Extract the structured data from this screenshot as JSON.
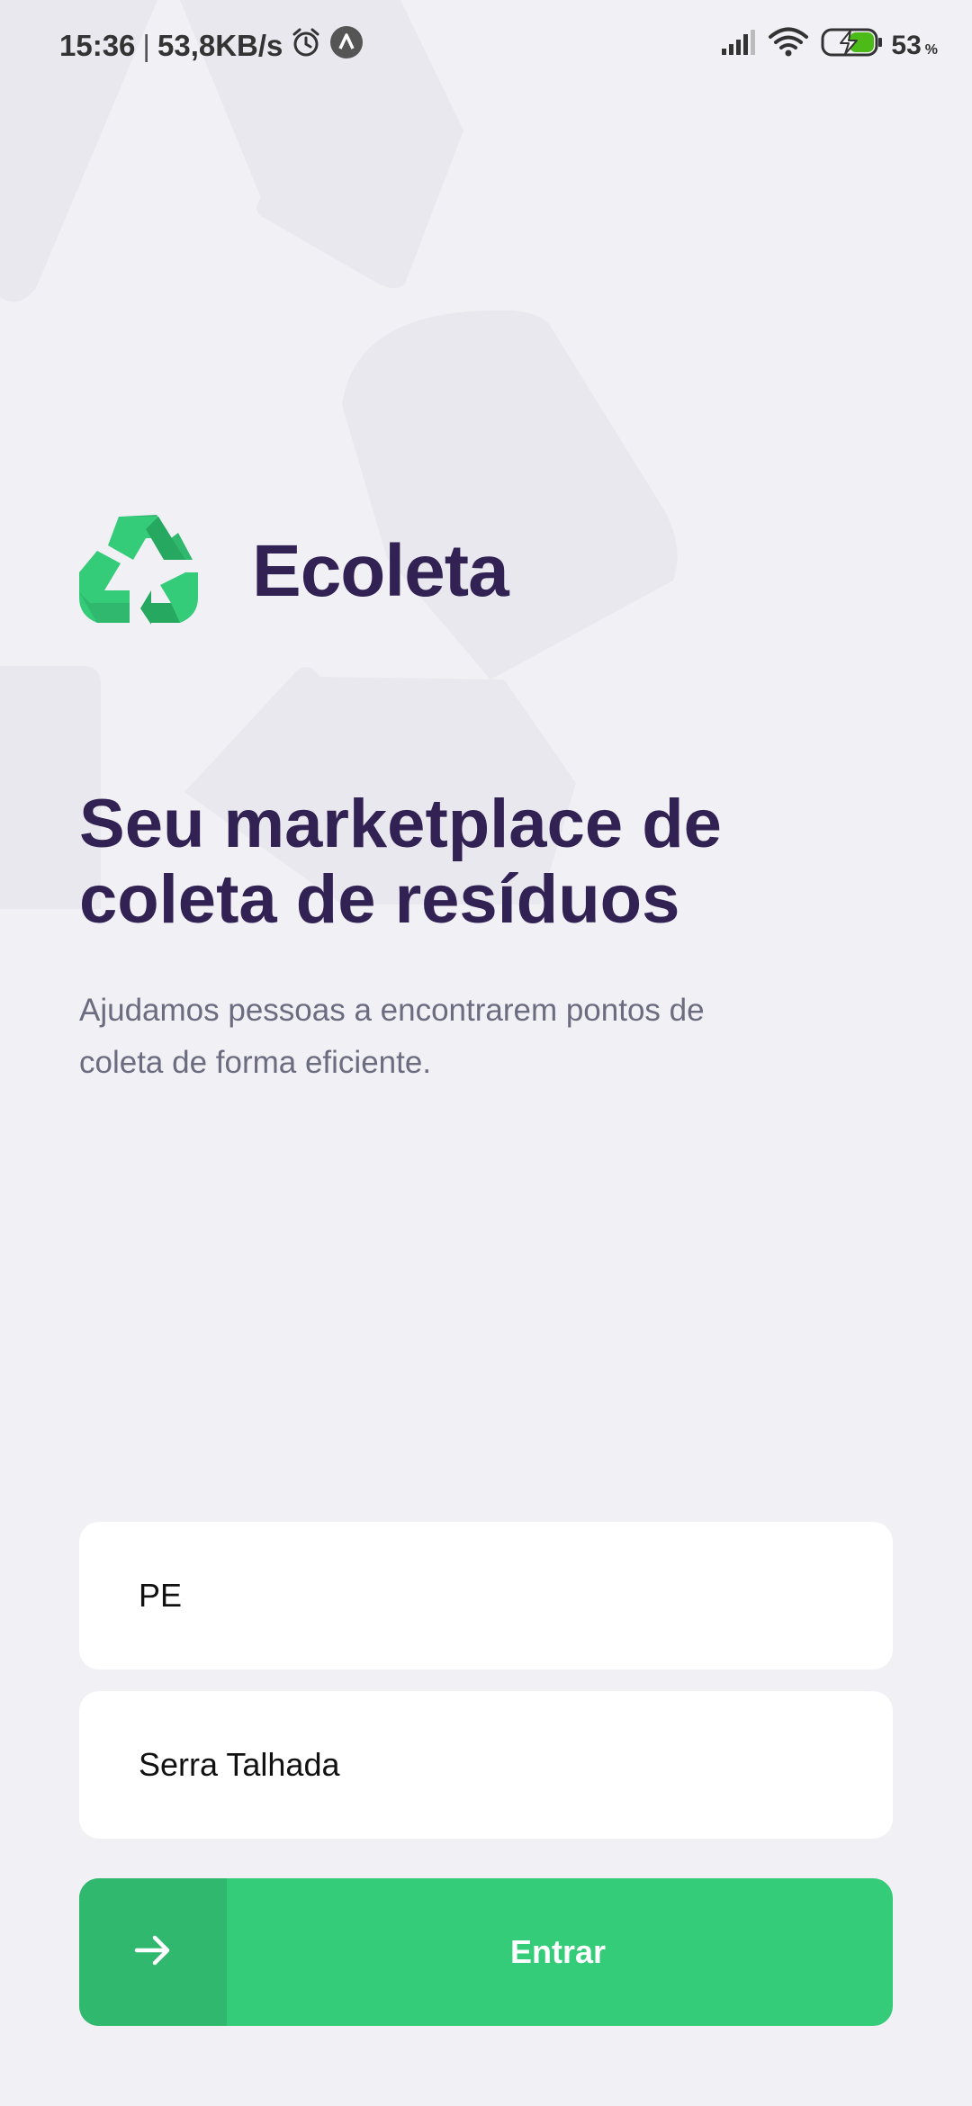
{
  "status_bar": {
    "time": "15:36",
    "separator": "|",
    "speed": "53,8KB/s",
    "battery_percent": "53",
    "battery_unit": "%",
    "icons": [
      "alarm-clock-icon",
      "nav-app-icon",
      "signal-icon",
      "wifi-icon",
      "battery-charging-icon"
    ]
  },
  "brand": {
    "name": "Ecoleta",
    "logo_icon": "recycle-icon",
    "colors": {
      "primary": "#34cb79",
      "title": "#322153",
      "text": "#6c6c80",
      "background": "#f0f0f5"
    }
  },
  "main": {
    "headline": "Seu marketplace de coleta de resíduos",
    "description": "Ajudamos pessoas a encontrarem pontos de coleta de forma eficiente."
  },
  "form": {
    "uf_value": "PE",
    "city_value": "Serra Talhada",
    "enter_label": "Entrar",
    "enter_icon": "arrow-right-icon"
  }
}
